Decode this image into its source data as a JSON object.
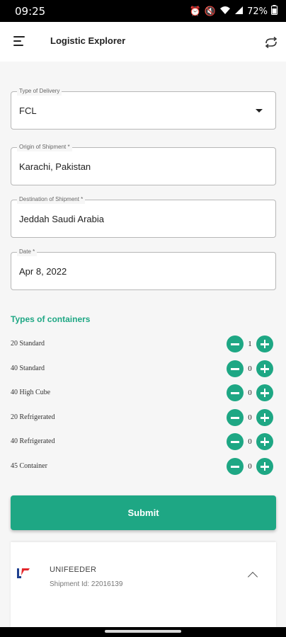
{
  "status": {
    "time": "09:25",
    "battery": "72%"
  },
  "app": {
    "title": "Logistic Explorer"
  },
  "form": {
    "delivery": {
      "label": "Type of Delivery",
      "value": "FCL"
    },
    "origin": {
      "label": "Origin of Shipment *",
      "value": "Karachi, Pakistan"
    },
    "destination": {
      "label": "Destination of Shipment *",
      "value": "Jeddah Saudi Arabia"
    },
    "date": {
      "label": "Date *",
      "value": "Apr 8, 2022"
    }
  },
  "containers": {
    "title": "Types of containers",
    "items": [
      {
        "label": "20 Standard",
        "count": "1"
      },
      {
        "label": "40 Standard",
        "count": "0"
      },
      {
        "label": "40 High Cube",
        "count": "0"
      },
      {
        "label": "20 Refrigerated",
        "count": "0"
      },
      {
        "label": "40 Refrigerated",
        "count": "0"
      },
      {
        "label": "45 Container",
        "count": "0"
      }
    ]
  },
  "submit_label": "Submit",
  "result": {
    "carrier": "UNIFEEDER",
    "shipment": "Shipment Id: 22016139"
  },
  "colors": {
    "accent": "#1ea784",
    "background": "#f6f6f6"
  }
}
